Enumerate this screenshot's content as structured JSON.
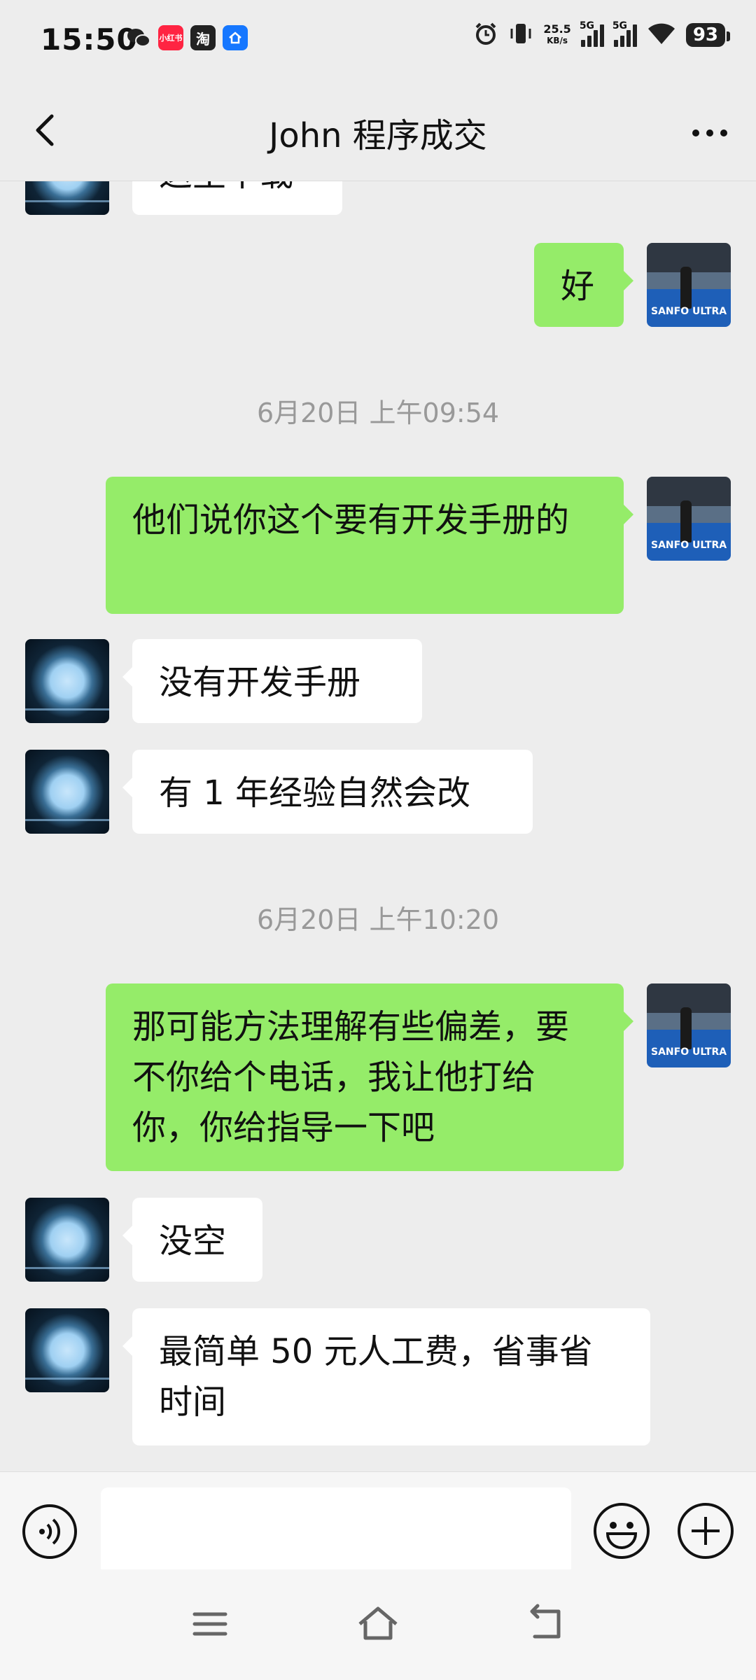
{
  "status_bar": {
    "time": "15:50",
    "app_icons": [
      {
        "name": "wechat-notification-icon",
        "label": ""
      },
      {
        "name": "xiaohongshu-notification-icon",
        "label": "小红书"
      },
      {
        "name": "taobao-notification-icon",
        "label": "淘"
      },
      {
        "name": "alipay-notification-icon",
        "label": ""
      }
    ],
    "net_speed_value": "25.5",
    "net_speed_unit": "KB/s",
    "signal1_label": "5G",
    "signal2_label": "5G",
    "battery": "93"
  },
  "header": {
    "title": "John 程序成交"
  },
  "messages": {
    "m0": "这里下载",
    "m1": "好",
    "t1": "6月20日 上午09:54",
    "m2": "他们说你这个要有开发手册的",
    "m3": "没有开发手册",
    "m4": "有 1 年经验自然会改",
    "t2": "6月20日 上午10:20",
    "m5": "那可能方法理解有些偏差，要不你给个电话，我让他打给你，你给指导一下吧",
    "m6": "没空",
    "m7": "最简单 50 元人工费，省事省时间"
  },
  "avatars": {
    "self_photo_text": "SANFO ULTRA"
  },
  "input": {
    "placeholder": ""
  },
  "colors": {
    "background": "#ededed",
    "outgoing_bubble": "#95ec69",
    "incoming_bubble": "#ffffff",
    "timestamp": "#999999"
  }
}
